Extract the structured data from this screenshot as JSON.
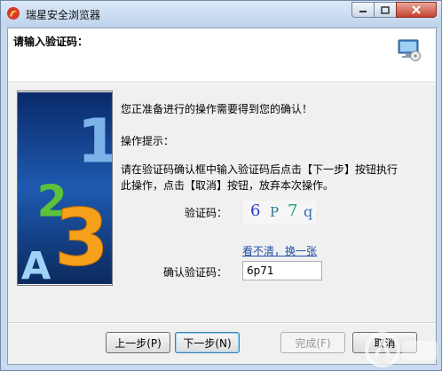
{
  "window": {
    "title": "瑞星安全浏览器"
  },
  "header": {
    "title": "请输入验证码：",
    "icon": "computer-disc-icon"
  },
  "messages": {
    "line1": "您正准备进行的操作需要得到您的确认！",
    "line2": "操作提示：",
    "line3": "请在验证码确认框中输入验证码后点击【下一步】按钮执行",
    "line4": "此操作，点击【取消】按钮，放弃本次操作。"
  },
  "captcha": {
    "label": "验证码：",
    "chars": [
      "6",
      "P",
      "7",
      "q"
    ],
    "char_colors": [
      "#2b3fd0",
      "#2a7a8c",
      "#1fa06a",
      "#2d6fb8"
    ],
    "refresh_link": "看不清，换一张"
  },
  "confirm": {
    "label": "确认验证码：",
    "value": "6p71"
  },
  "buttons": {
    "prev": "上一步(P)",
    "next": "下一步(N)",
    "finish": "完成(F)",
    "cancel": "取消"
  },
  "side_image": {
    "glyphs": [
      "1",
      "2",
      "3",
      "A"
    ]
  },
  "colors": {
    "titlebar": "#c9daee",
    "link": "#1c4fa8"
  }
}
